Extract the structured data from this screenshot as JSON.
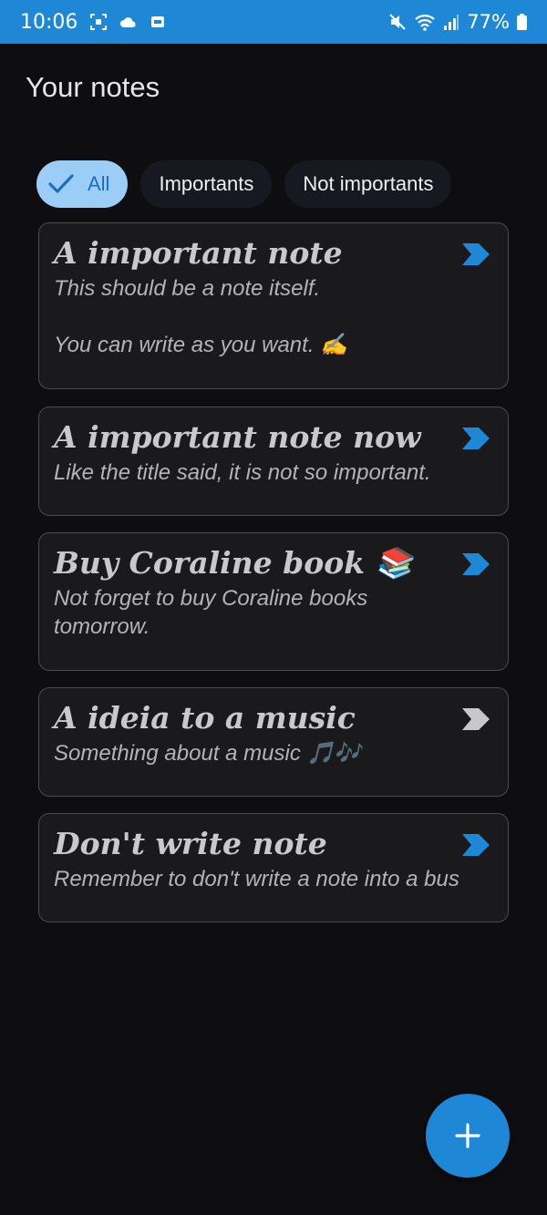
{
  "status_bar": {
    "time": "10:06",
    "battery": "77%",
    "icons": [
      "screenshot-icon",
      "cloud-icon",
      "gallery-icon",
      "mute-icon",
      "wifi-icon",
      "signal-icon",
      "battery-icon"
    ]
  },
  "header": {
    "title": "Your notes"
  },
  "filters": {
    "items": [
      {
        "label": "All",
        "selected": true
      },
      {
        "label": "Importants",
        "selected": false
      },
      {
        "label": "Not importants",
        "selected": false
      }
    ]
  },
  "notes": [
    {
      "title": "A important note",
      "body": "This should be a note itself.\n\nYou can write as you want. ✍",
      "important": true
    },
    {
      "title": "A important note now",
      "body": "Like the title said, it is not so important.",
      "important": true
    },
    {
      "title": "Buy Coraline book 📚",
      "body": "Not forget to buy Coraline books\ntomorrow.",
      "important": true
    },
    {
      "title": "A ideia to a music",
      "body": "Something about a music 🎵🎶",
      "important": false
    },
    {
      "title": "Don't write note",
      "body": "Remember to don't write a note into a bus",
      "important": true
    }
  ],
  "colors": {
    "accent": "#1e88d6",
    "chip_selected_bg": "#9ccdf6",
    "important_arrow": "#1e88d6",
    "not_important_arrow": "#c8c8cc"
  },
  "fab": {
    "icon": "plus-icon"
  }
}
